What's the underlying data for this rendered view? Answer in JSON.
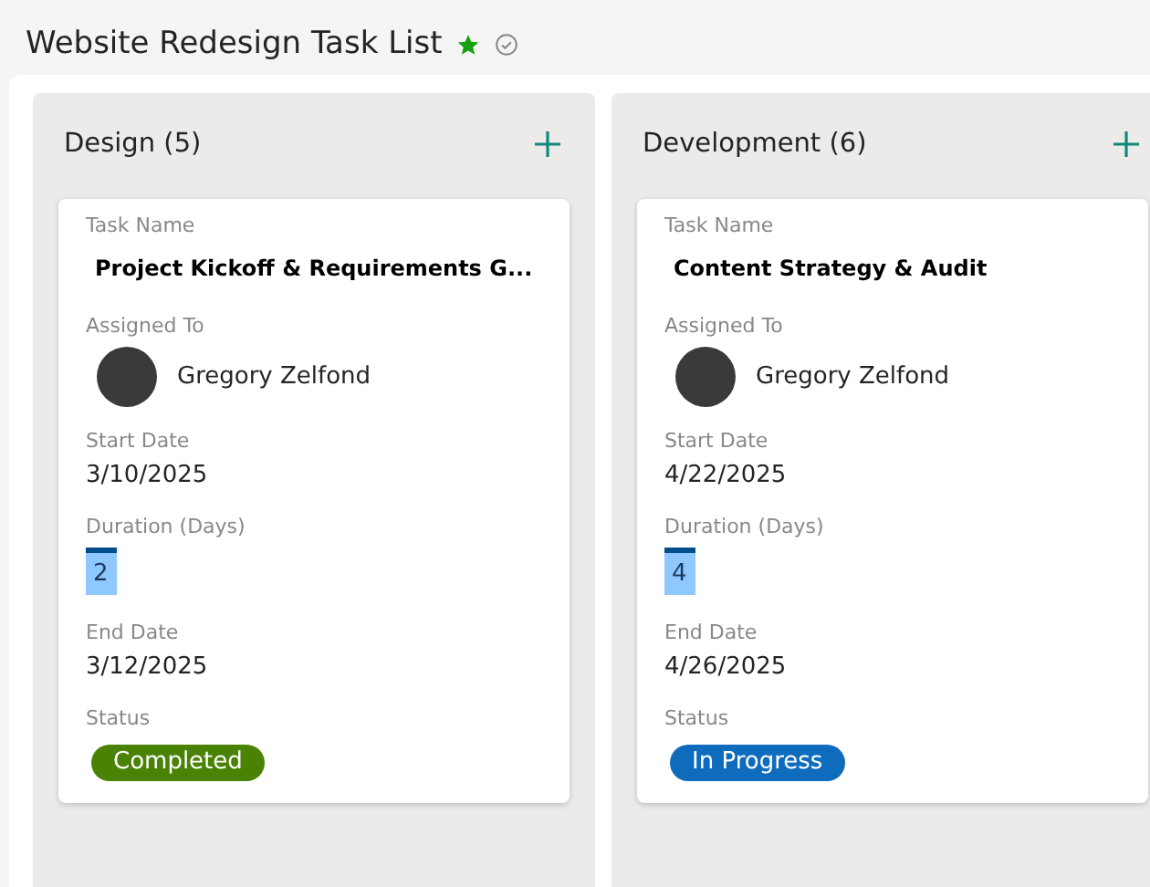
{
  "title": "Website Redesign Task List",
  "favorite": true,
  "columns": [
    {
      "heading": "Design (5)",
      "card": {
        "task_label": "Task Name",
        "task": "Project Kickoff & Requirements G...",
        "assigned_label": "Assigned To",
        "assignee": "Gregory Zelfond",
        "start_label": "Start Date",
        "start": "3/10/2025",
        "duration_label": "Duration (Days)",
        "duration": "2",
        "end_label": "End Date",
        "end": "3/12/2025",
        "status_label": "Status",
        "status": {
          "text": "Completed",
          "color": "#498205"
        }
      }
    },
    {
      "heading": "Development (6)",
      "card": {
        "task_label": "Task Name",
        "task": "Content Strategy & Audit",
        "assigned_label": "Assigned To",
        "assignee": "Gregory Zelfond",
        "start_label": "Start Date",
        "start": "4/22/2025",
        "duration_label": "Duration (Days)",
        "duration": "4",
        "end_label": "End Date",
        "end": "4/26/2025",
        "status_label": "Status",
        "status": {
          "text": "In Progress",
          "color": "#0f6cbd"
        }
      }
    }
  ]
}
